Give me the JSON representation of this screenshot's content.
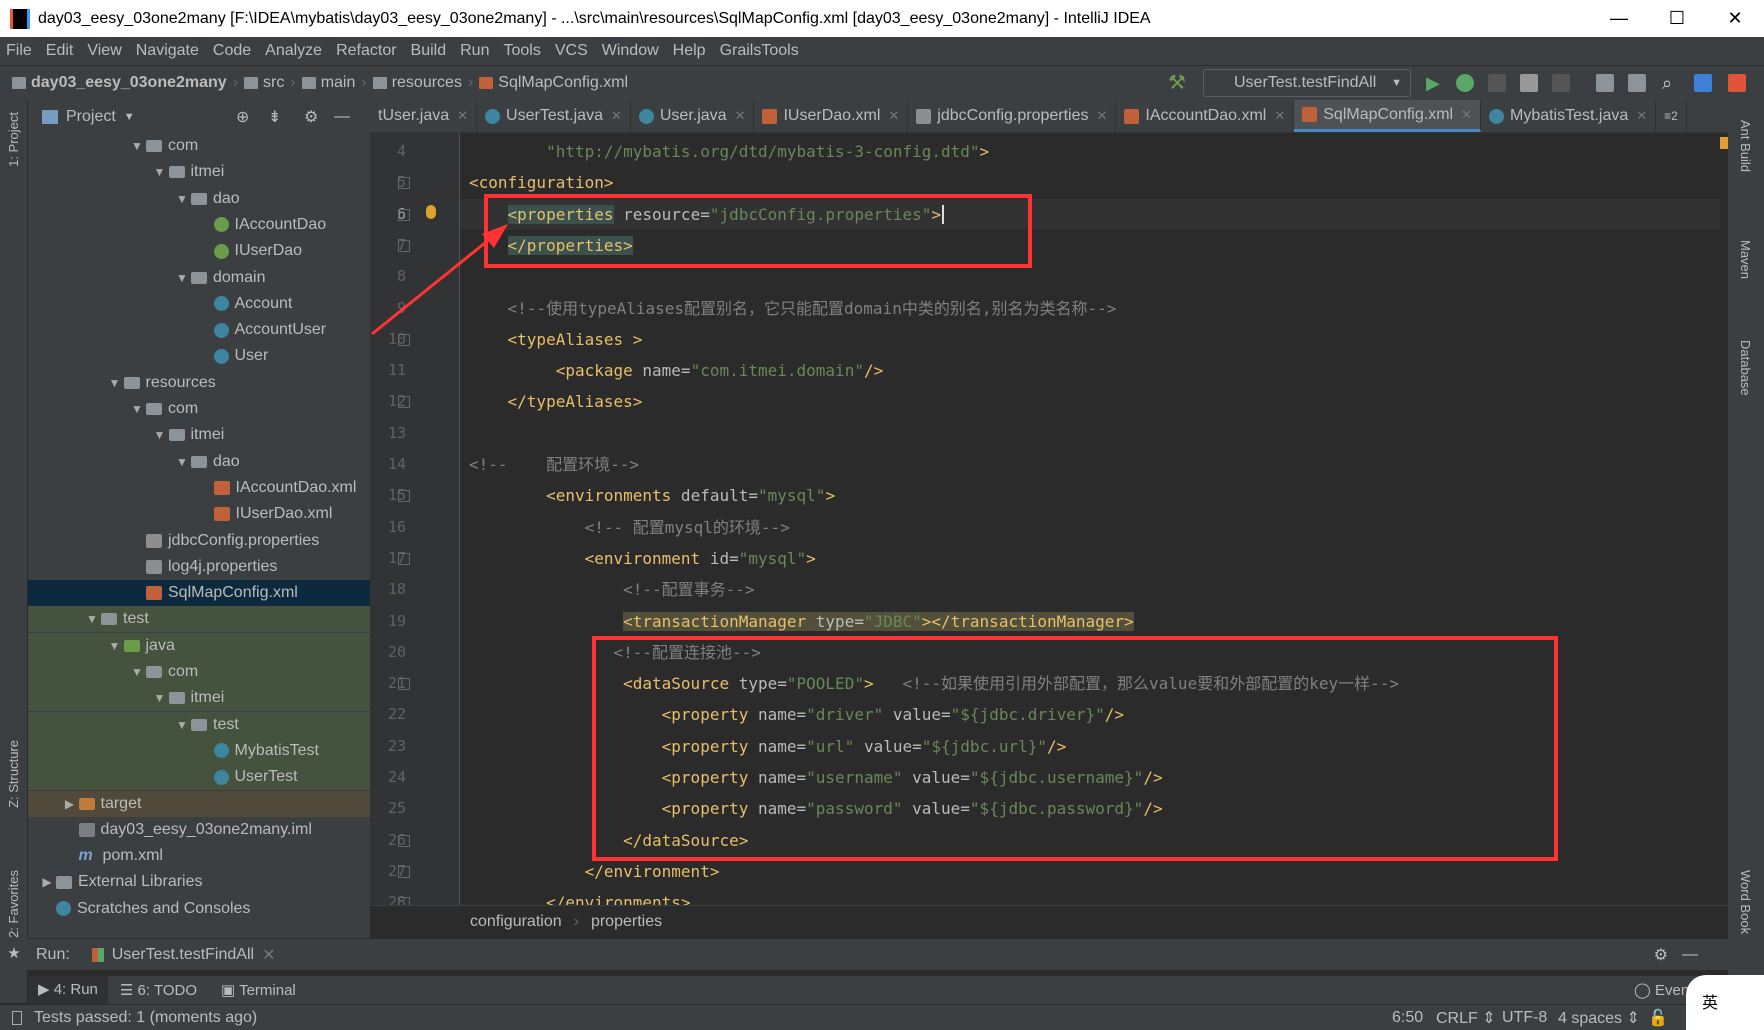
{
  "window": {
    "title": "day03_eesy_03one2many [F:\\IDEA\\mybatis\\day03_eesy_03one2many] - ...\\src\\main\\resources\\SqlMapConfig.xml [day03_eesy_03one2many] - IntelliJ IDEA",
    "minimize": "—",
    "maximize": "☐",
    "close": "✕"
  },
  "menu": [
    "File",
    "Edit",
    "View",
    "Navigate",
    "Code",
    "Analyze",
    "Refactor",
    "Build",
    "Run",
    "Tools",
    "VCS",
    "Window",
    "Help",
    "GrailsTools"
  ],
  "breadcrumb": [
    "day03_eesy_03one2many",
    "src",
    "main",
    "resources",
    "SqlMapConfig.xml"
  ],
  "run_config": "UserTest.testFindAll",
  "left_strip": {
    "project": "1: Project",
    "structure": "Z: Structure",
    "favorites": "2: Favorites"
  },
  "right_strip": {
    "ant": "Ant Build",
    "maven": "Maven",
    "database": "Database",
    "wordbook": "Word Book"
  },
  "project_panel": {
    "title": "Project"
  },
  "tree": [
    {
      "d": 4,
      "arr": "▼",
      "icon": "folder",
      "label": "com"
    },
    {
      "d": 5,
      "arr": "▼",
      "icon": "folder",
      "label": "itmei"
    },
    {
      "d": 6,
      "arr": "▼",
      "icon": "folder",
      "label": "dao"
    },
    {
      "d": 7,
      "icon": "iface",
      "label": "IAccountDao"
    },
    {
      "d": 7,
      "icon": "iface",
      "label": "IUserDao"
    },
    {
      "d": 6,
      "arr": "▼",
      "icon": "folder",
      "label": "domain"
    },
    {
      "d": 7,
      "icon": "cls",
      "label": "Account"
    },
    {
      "d": 7,
      "icon": "cls",
      "label": "AccountUser"
    },
    {
      "d": 7,
      "icon": "cls",
      "label": "User"
    },
    {
      "d": 3,
      "arr": "▼",
      "icon": "folder",
      "label": "resources"
    },
    {
      "d": 4,
      "arr": "▼",
      "icon": "folder",
      "label": "com"
    },
    {
      "d": 5,
      "arr": "▼",
      "icon": "folder",
      "label": "itmei"
    },
    {
      "d": 6,
      "arr": "▼",
      "icon": "folder",
      "label": "dao"
    },
    {
      "d": 7,
      "icon": "xml",
      "label": "IAccountDao.xml"
    },
    {
      "d": 7,
      "icon": "xml",
      "label": "IUserDao.xml"
    },
    {
      "d": 4,
      "icon": "props",
      "label": "jdbcConfig.properties"
    },
    {
      "d": 4,
      "icon": "props",
      "label": "log4j.properties"
    },
    {
      "d": 4,
      "icon": "xml",
      "label": "SqlMapConfig.xml",
      "bg": "#0d293e"
    },
    {
      "d": 2,
      "arr": "▼",
      "icon": "folder",
      "label": "test",
      "bg": "#45523e"
    },
    {
      "d": 3,
      "arr": "▼",
      "icon": "folder-green",
      "label": "java",
      "bg": "#45523e"
    },
    {
      "d": 4,
      "arr": "▼",
      "icon": "folder",
      "label": "com",
      "bg": "#45523e"
    },
    {
      "d": 5,
      "arr": "▼",
      "icon": "folder",
      "label": "itmei",
      "bg": "#45523e"
    },
    {
      "d": 6,
      "arr": "▼",
      "icon": "folder",
      "label": "test",
      "bg": "#45523e"
    },
    {
      "d": 7,
      "icon": "cls",
      "label": "MybatisTest",
      "bg": "#45523e"
    },
    {
      "d": 7,
      "icon": "cls",
      "label": "UserTest",
      "bg": "#45523e"
    },
    {
      "d": 1,
      "arr": "▶",
      "icon": "folder-orange",
      "label": "target",
      "bg": "#51493a"
    },
    {
      "d": 1,
      "icon": "iml",
      "label": "day03_eesy_03one2many.iml"
    },
    {
      "d": 1,
      "icon": "mvn",
      "label": "pom.xml"
    },
    {
      "d": 0,
      "arr": "▶",
      "icon": "lib",
      "label": "External Libraries"
    },
    {
      "d": 0,
      "icon": "cls",
      "label": "Scratches and Consoles"
    }
  ],
  "tabs": [
    {
      "label": "tUser.java",
      "icon": "none"
    },
    {
      "label": "UserTest.java",
      "icon": "c"
    },
    {
      "label": "User.java",
      "icon": "c"
    },
    {
      "label": "IUserDao.xml",
      "icon": "x"
    },
    {
      "label": "jdbcConfig.properties",
      "icon": "p"
    },
    {
      "label": "IAccountDao.xml",
      "icon": "x"
    },
    {
      "label": "SqlMapConfig.xml",
      "icon": "x",
      "active": true
    },
    {
      "label": "MybatisTest.java",
      "icon": "c"
    }
  ],
  "tabs_overflow": "≡2",
  "current_line": 6,
  "code": [
    {
      "n": 4,
      "ind": 8,
      "tk": [
        [
          "v",
          "\"http://mybatis.org/dtd/mybatis-3-config.dtd\""
        ],
        [
          "t",
          ">"
        ]
      ]
    },
    {
      "n": 5,
      "ind": 0,
      "fold": true,
      "tk": [
        [
          "t",
          "<configuration>"
        ]
      ]
    },
    {
      "n": 6,
      "ind": 4,
      "fold": true,
      "tk": [
        [
          "t hl",
          "<properties"
        ],
        [
          "a",
          " resource="
        ],
        [
          "v",
          "\"jdbcConfig.properties\""
        ],
        [
          "t",
          ">"
        ]
      ]
    },
    {
      "n": 7,
      "ind": 4,
      "fold": true,
      "tk": [
        [
          "t hl",
          "</properties>"
        ]
      ]
    },
    {
      "n": 8,
      "ind": 0,
      "tk": []
    },
    {
      "n": 9,
      "ind": 4,
      "tk": [
        [
          "c",
          "<!--使用typeAliases配置别名，它只能配置domain中类的别名,别名为类名称-->"
        ]
      ]
    },
    {
      "n": 10,
      "ind": 4,
      "fold": true,
      "tk": [
        [
          "t",
          "<typeAliases >"
        ]
      ]
    },
    {
      "n": 11,
      "ind": 9,
      "tk": [
        [
          "t",
          "<package"
        ],
        [
          "a",
          " name="
        ],
        [
          "v",
          "\"com.itmei.domain\""
        ],
        [
          "t",
          "/>"
        ]
      ]
    },
    {
      "n": 12,
      "ind": 4,
      "fold": true,
      "tk": [
        [
          "t",
          "</typeAliases>"
        ]
      ]
    },
    {
      "n": 13,
      "ind": 0,
      "tk": []
    },
    {
      "n": 14,
      "ind": 0,
      "tk": [
        [
          "c",
          "<!--    配置环境-->"
        ]
      ]
    },
    {
      "n": 15,
      "ind": 8,
      "fold": true,
      "tk": [
        [
          "t",
          "<environments"
        ],
        [
          "a",
          " default="
        ],
        [
          "v",
          "\"mysql\""
        ],
        [
          "t",
          ">"
        ]
      ]
    },
    {
      "n": 16,
      "ind": 12,
      "tk": [
        [
          "c",
          "<!-- 配置mysql的环境-->"
        ]
      ]
    },
    {
      "n": 17,
      "ind": 12,
      "fold": true,
      "tk": [
        [
          "t",
          "<environment"
        ],
        [
          "a",
          " id="
        ],
        [
          "v",
          "\"mysql\""
        ],
        [
          "t",
          ">"
        ]
      ]
    },
    {
      "n": 18,
      "ind": 16,
      "tk": [
        [
          "c",
          "<!--配置事务-->"
        ]
      ]
    },
    {
      "n": 19,
      "ind": 16,
      "tk": [
        [
          "t hl2",
          "<transactionManager"
        ],
        [
          "a hl2",
          " type="
        ],
        [
          "v hl2",
          "\"JDBC\""
        ],
        [
          "t hl2",
          "></transactionManager>"
        ]
      ]
    },
    {
      "n": 20,
      "ind": 15,
      "tk": [
        [
          "c",
          "<!--配置连接池-->"
        ]
      ]
    },
    {
      "n": 21,
      "ind": 16,
      "fold": true,
      "tk": [
        [
          "t",
          "<dataSource"
        ],
        [
          "a",
          " type="
        ],
        [
          "v",
          "\"POOLED\""
        ],
        [
          "t",
          ">"
        ],
        [
          "p",
          "   "
        ],
        [
          "c",
          "<!--如果使用引用外部配置，那么value要和外部配置的key一样-->"
        ]
      ]
    },
    {
      "n": 22,
      "ind": 20,
      "tk": [
        [
          "t",
          "<property"
        ],
        [
          "a",
          " name="
        ],
        [
          "v",
          "\"driver\""
        ],
        [
          "a",
          " value="
        ],
        [
          "v",
          "\"${jdbc.driver}\""
        ],
        [
          "t",
          "/>"
        ]
      ]
    },
    {
      "n": 23,
      "ind": 20,
      "tk": [
        [
          "t",
          "<property"
        ],
        [
          "a",
          " name="
        ],
        [
          "v",
          "\"url\""
        ],
        [
          "a",
          " value="
        ],
        [
          "v",
          "\"${jdbc.url}\""
        ],
        [
          "t",
          "/>"
        ]
      ]
    },
    {
      "n": 24,
      "ind": 20,
      "tk": [
        [
          "t",
          "<property"
        ],
        [
          "a",
          " name="
        ],
        [
          "v",
          "\"username\""
        ],
        [
          "a",
          " value="
        ],
        [
          "v",
          "\"${jdbc.username}\""
        ],
        [
          "t",
          "/>"
        ]
      ]
    },
    {
      "n": 25,
      "ind": 20,
      "tk": [
        [
          "t",
          "<property"
        ],
        [
          "a",
          " name="
        ],
        [
          "v",
          "\"password\""
        ],
        [
          "a",
          " value="
        ],
        [
          "v",
          "\"${jdbc.password}\""
        ],
        [
          "t",
          "/>"
        ]
      ]
    },
    {
      "n": 26,
      "ind": 16,
      "fold": true,
      "tk": [
        [
          "t",
          "</dataSource>"
        ]
      ]
    },
    {
      "n": 27,
      "ind": 12,
      "fold": true,
      "tk": [
        [
          "t",
          "</environment>"
        ]
      ]
    },
    {
      "n": 28,
      "ind": 8,
      "fold": true,
      "tk": [
        [
          "t",
          "</environments>"
        ]
      ]
    }
  ],
  "editor_breadcrumb": [
    "configuration",
    "properties"
  ],
  "run_panel": {
    "label": "Run:",
    "tab": "UserTest.testFindAll"
  },
  "tool_tabs": [
    "4: Run",
    "6: TODO",
    "Terminal"
  ],
  "event_log": "Even",
  "ime": "英",
  "status": {
    "message": "Tests passed: 1 (moments ago)",
    "position": "6:50",
    "line_sep": "CRLF",
    "encoding": "UTF-8",
    "indent": "4 spaces"
  },
  "colors": {
    "tag": "#e8bf6a",
    "attr": "#bababa",
    "value": "#6a8759",
    "comment": "#808080",
    "annotation": "#ff3333"
  }
}
